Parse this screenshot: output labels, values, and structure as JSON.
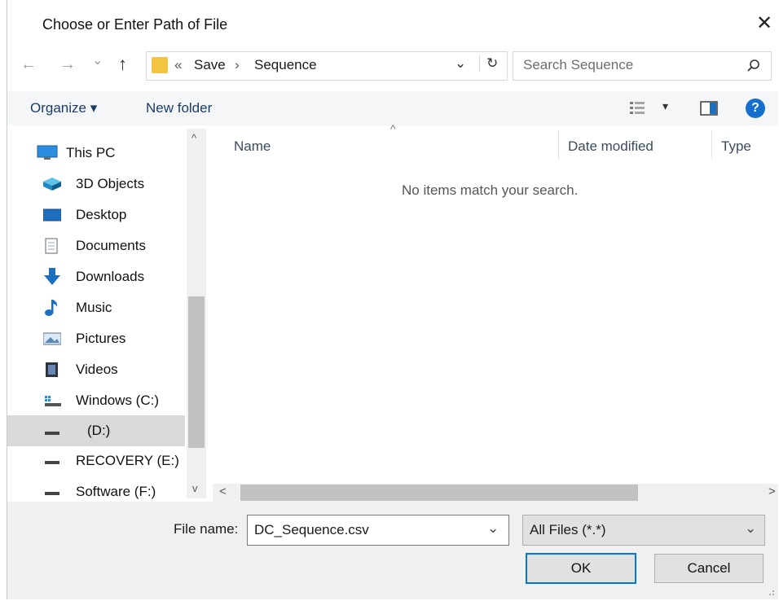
{
  "window": {
    "title": "Choose or Enter Path of File",
    "close_glyph": "✕"
  },
  "nav_buttons": {
    "back": "←",
    "forward": "→",
    "recent": "⌄",
    "up": "↑"
  },
  "breadcrumb": {
    "prefix": "«",
    "items": [
      "Save",
      "Sequence"
    ],
    "separator": "›",
    "dropdown_glyph": "⌄",
    "refresh_glyph": "↻"
  },
  "search": {
    "placeholder": "Search Sequence",
    "icon": "search-icon"
  },
  "toolbar": {
    "organize_label": "Organize ▾",
    "new_folder_label": "New folder",
    "view_dropdown": "▾",
    "help_glyph": "?"
  },
  "sidebar": {
    "items": [
      {
        "label": "This PC",
        "icon": "this-pc-icon"
      },
      {
        "label": "3D Objects",
        "icon": "3d-objects-icon"
      },
      {
        "label": "Desktop",
        "icon": "desktop-icon"
      },
      {
        "label": "Documents",
        "icon": "documents-icon"
      },
      {
        "label": "Downloads",
        "icon": "downloads-icon"
      },
      {
        "label": "Music",
        "icon": "music-icon"
      },
      {
        "label": "Pictures",
        "icon": "pictures-icon"
      },
      {
        "label": "Videos",
        "icon": "videos-icon"
      },
      {
        "label": "Windows (C:)",
        "icon": "windows-drive-icon"
      },
      {
        "label": "(D:)",
        "icon": "drive-icon",
        "selected": true
      },
      {
        "label": "RECOVERY (E:)",
        "icon": "drive-icon"
      },
      {
        "label": "Software (F:)",
        "icon": "drive-icon"
      }
    ]
  },
  "columns": {
    "name": "Name",
    "date_modified": "Date modified",
    "type": "Type",
    "sort_glyph": "^"
  },
  "empty_message": "No items match your search.",
  "scroll": {
    "up": "^",
    "down": "v",
    "left": "<",
    "right": ">"
  },
  "footer": {
    "file_name_label": "File name:",
    "file_name_value": "DC_Sequence.csv",
    "file_type_value": "All Files (*.*)",
    "dropdown_glyph": "⌄",
    "ok_label": "OK",
    "cancel_label": "Cancel"
  },
  "colors": {
    "accent": "#0078d7",
    "folder": "#f3c342",
    "help": "#1470cc"
  }
}
